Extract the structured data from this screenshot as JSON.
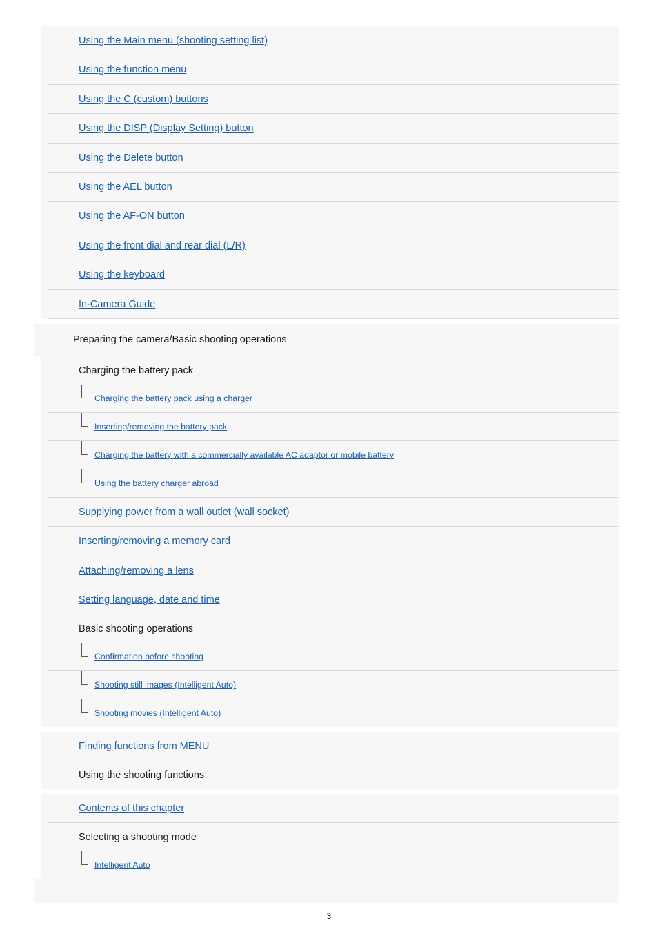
{
  "page": {
    "number": "3",
    "background": "#ffffff",
    "pane_background": "#f7f7f7",
    "link_color": "#1a5fa8",
    "text_color": "#1a1a1a"
  },
  "toc": {
    "items": [
      {
        "label": "Using the Main menu (shooting setting list)",
        "type": "link",
        "level": 1
      },
      {
        "label": "Using the function menu",
        "type": "link",
        "level": 1
      },
      {
        "label": "Using the C (custom) buttons",
        "type": "link",
        "level": 1
      },
      {
        "label": "Using the DISP (Display Setting) button",
        "type": "link",
        "level": 1
      },
      {
        "label": "Using the Delete button",
        "type": "link",
        "level": 1
      },
      {
        "label": "Using the AEL button",
        "type": "link",
        "level": 1
      },
      {
        "label": "Using the AF-ON button",
        "type": "link",
        "level": 1
      },
      {
        "label": "Using the front dial and rear dial (L/R)",
        "type": "link",
        "level": 1
      },
      {
        "label": "Using the keyboard",
        "type": "link",
        "level": 1
      },
      {
        "label": "In-Camera Guide",
        "type": "link",
        "level": 1
      },
      {
        "label": "Preparing the camera/Basic shooting operations",
        "type": "plain",
        "level": 0
      },
      {
        "label": "Charging the battery pack",
        "type": "plain",
        "level": 1
      },
      {
        "label": "Charging the battery pack using a charger",
        "type": "link",
        "level": 2
      },
      {
        "label": "Inserting/removing the battery pack",
        "type": "link",
        "level": 2
      },
      {
        "label": "Charging the battery with a commercially available AC adaptor or mobile battery",
        "type": "link",
        "level": 2
      },
      {
        "label": "Using the battery charger abroad",
        "type": "link",
        "level": 2
      },
      {
        "label": "Supplying power from a wall outlet (wall socket)",
        "type": "link",
        "level": 1
      },
      {
        "label": "Inserting/removing a memory card",
        "type": "link",
        "level": 1
      },
      {
        "label": "Attaching/removing a lens",
        "type": "link",
        "level": 1
      },
      {
        "label": "Setting language, date and time",
        "type": "link",
        "level": 1
      },
      {
        "label": "Basic shooting operations",
        "type": "plain",
        "level": 1
      },
      {
        "label": "Confirmation before shooting",
        "type": "link",
        "level": 2
      },
      {
        "label": "Shooting still images (Intelligent Auto)",
        "type": "link",
        "level": 2
      },
      {
        "label": "Shooting movies (Intelligent Auto)",
        "type": "link",
        "level": 2
      },
      {
        "label": "Finding functions from MENU",
        "type": "link",
        "level": 1
      },
      {
        "label": "Using the shooting functions",
        "type": "plain",
        "level": 1
      },
      {
        "label": "Contents of this chapter",
        "type": "link",
        "level": 1
      },
      {
        "label": "Selecting a shooting mode",
        "type": "plain",
        "level": 1
      },
      {
        "label": "Intelligent Auto",
        "type": "link",
        "level": 2
      }
    ]
  }
}
